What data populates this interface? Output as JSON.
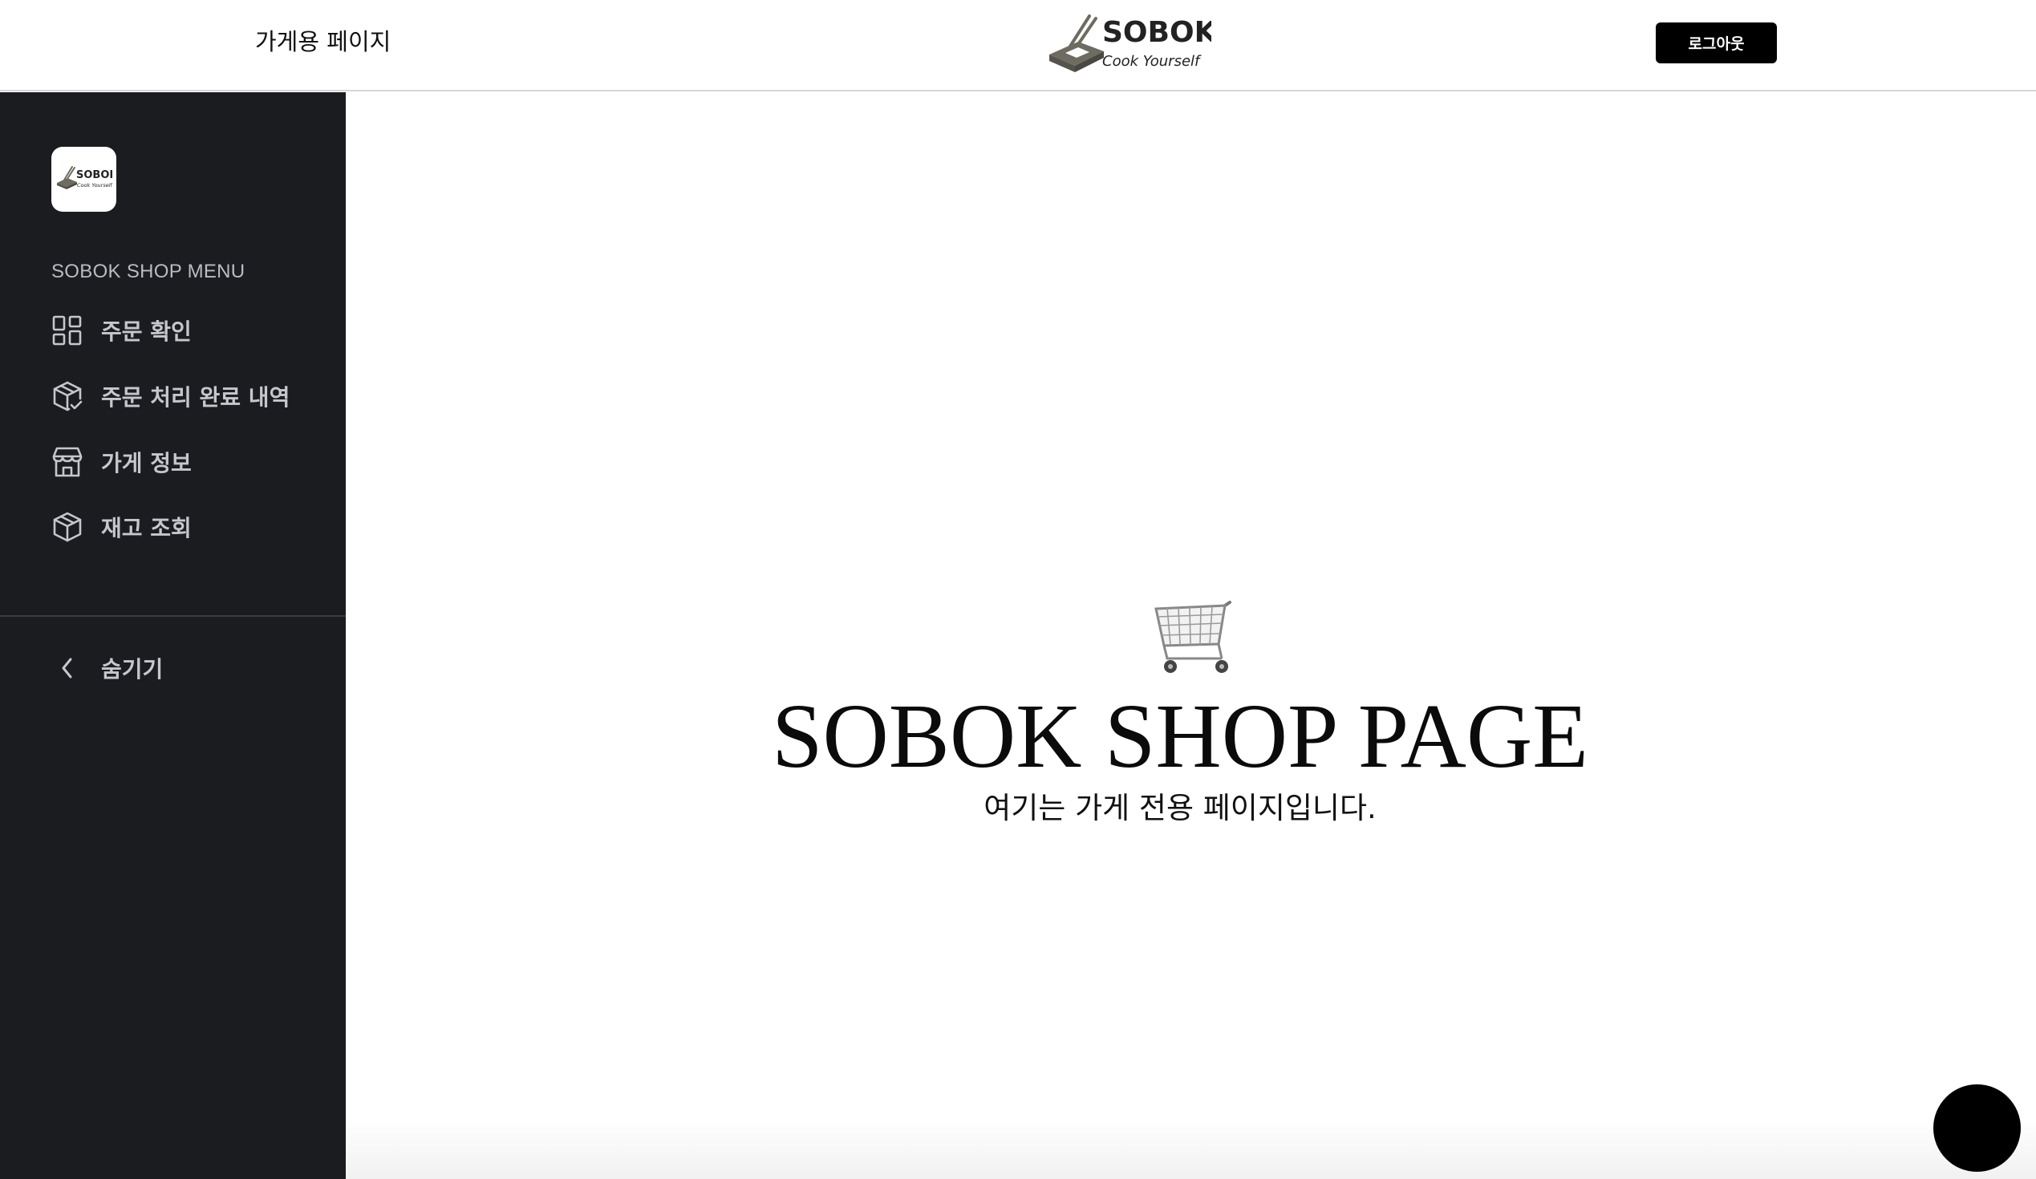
{
  "header": {
    "title": "가게용 페이지",
    "brand": {
      "name": "SOBOK",
      "tagline": "Cook Yourself"
    },
    "logout_label": "로그아웃"
  },
  "sidebar": {
    "logo": {
      "name": "SOBOK",
      "tagline": "Cook Yourself"
    },
    "menu_heading": "SOBOK SHOP MENU",
    "items": [
      {
        "label": "주문 확인",
        "icon": "grid-icon"
      },
      {
        "label": "주문 처리 완료 내역",
        "icon": "box-check-icon"
      },
      {
        "label": "가게 정보",
        "icon": "store-icon"
      },
      {
        "label": "재고 조회",
        "icon": "box-icon"
      }
    ],
    "collapse_label": "숨기기",
    "collapse_icon": "chevron-left-icon"
  },
  "main": {
    "icon": "shopping-cart-icon",
    "title": "SOBOK SHOP PAGE",
    "subtitle": "여기는 가게 전용 페이지입니다."
  },
  "colors": {
    "sidebar_bg": "#1b1c1f",
    "sidebar_text": "#c4c7cd",
    "accent": "#000000",
    "logo_gray": "#6e6b60"
  }
}
